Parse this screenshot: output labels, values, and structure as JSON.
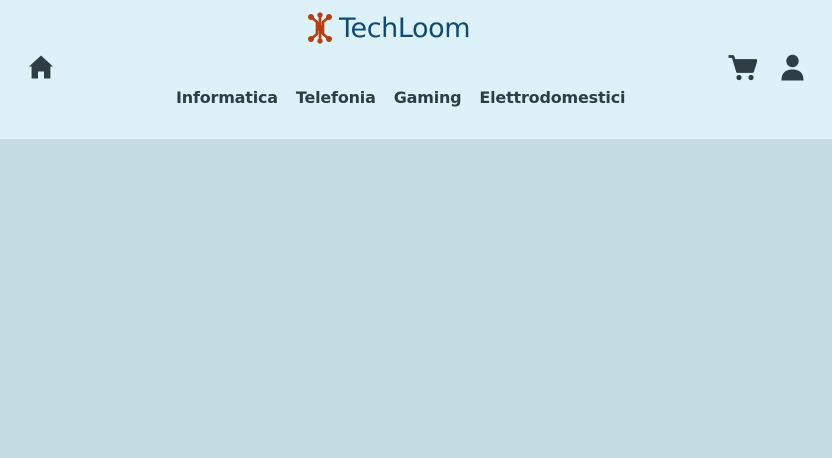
{
  "brand": {
    "name": "TechLoom",
    "icon": "network-node-icon",
    "text_color": "#0f4a75",
    "icon_color": "#b83b13"
  },
  "header": {
    "background": "#dcf2f8",
    "home_icon": "home-icon",
    "cart_icon": "cart-icon",
    "user_icon": "user-icon"
  },
  "nav": {
    "items": [
      {
        "label": "Informatica"
      },
      {
        "label": "Telefonia"
      },
      {
        "label": "Gaming"
      },
      {
        "label": "Elettrodomestici"
      }
    ]
  },
  "main": {
    "background": "#c5dce2"
  }
}
